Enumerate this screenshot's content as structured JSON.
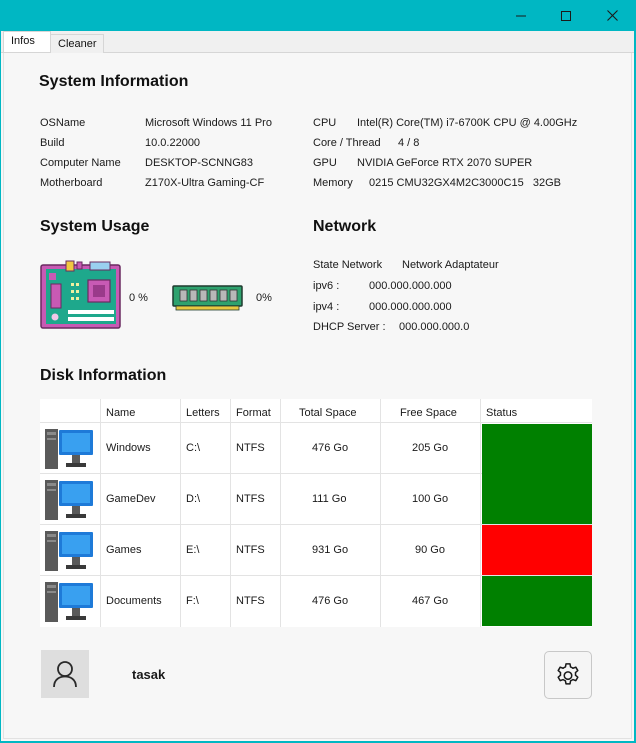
{
  "window": {
    "minimize_glyph": "—",
    "maximize_glyph": "□",
    "close_glyph": "✕"
  },
  "tabs": [
    {
      "label": "Infos",
      "selected": true
    },
    {
      "label": "Cleaner",
      "selected": false
    }
  ],
  "system_information": {
    "title": "System Information",
    "left": [
      {
        "label": "OSName",
        "value": "Microsoft Windows 11 Pro"
      },
      {
        "label": "Build",
        "value": "10.0.22000"
      },
      {
        "label": "Computer Name",
        "value": "DESKTOP-SCNNG83"
      },
      {
        "label": "Motherboard",
        "value": "Z170X-Ultra Gaming-CF"
      }
    ],
    "right": [
      {
        "label": "CPU",
        "value": "Intel(R) Core(TM) i7-6700K CPU @ 4.00GHz"
      },
      {
        "label": "Core / Thread",
        "value": "4 / 8"
      },
      {
        "label": "GPU",
        "value": "NVIDIA GeForce RTX 2070 SUPER"
      },
      {
        "label": "Memory",
        "value": "0215 CMU32GX4M2C3000C15   32GB"
      }
    ]
  },
  "system_usage": {
    "title": "System Usage",
    "cpu_percent": "0 %",
    "ram_percent": "0%"
  },
  "network": {
    "title": "Network",
    "state_label": "State Network",
    "state_value": "Network Adaptateur",
    "ipv6_label": "ipv6 :",
    "ipv6_value": "000.000.000.000",
    "ipv4_label": "ipv4 :",
    "ipv4_value": "000.000.000.000",
    "dhcp_label": "DHCP Server :",
    "dhcp_value": "000.000.000.0"
  },
  "disk_information": {
    "title": "Disk Information",
    "columns": [
      "",
      "Name",
      "Letters",
      "Format",
      "Total Space",
      "Free Space",
      "Status"
    ],
    "rows": [
      {
        "name": "Windows",
        "letter": "C:\\",
        "format": "NTFS",
        "total": "476 Go",
        "free": "205 Go",
        "status_color": "#008000"
      },
      {
        "name": "GameDev",
        "letter": "D:\\",
        "format": "NTFS",
        "total": "111 Go",
        "free": "100 Go",
        "status_color": "#008000"
      },
      {
        "name": "Games",
        "letter": "E:\\",
        "format": "NTFS",
        "total": "931 Go",
        "free": "90 Go",
        "status_color": "#ff0000"
      },
      {
        "name": "Documents",
        "letter": "F:\\",
        "format": "NTFS",
        "total": "476 Go",
        "free": "467 Go",
        "status_color": "#008000"
      }
    ]
  },
  "user": {
    "name": "tasak",
    "avatar_icon": "user-icon"
  },
  "settings": {
    "icon": "gear-icon"
  },
  "colors": {
    "accent": "#00b7c3",
    "ok": "#008000",
    "warn": "#ff0000"
  }
}
